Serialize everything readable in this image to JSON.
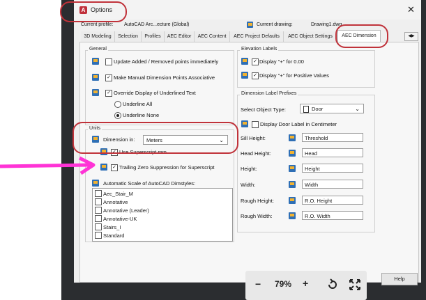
{
  "window": {
    "title": "Options",
    "close_glyph": "✕"
  },
  "profile": {
    "current_profile_label": "Current profile:",
    "current_profile_value": "AutoCAD Arc...ecture (Global)",
    "current_drawing_label": "Current drawing:",
    "current_drawing_value": "Drawing1.dwg"
  },
  "tabs": [
    "3D Modeling",
    "Selection",
    "Profiles",
    "AEC Editor",
    "AEC Content",
    "AEC Project Defaults",
    "AEC Object Settings",
    "AEC Dimension"
  ],
  "active_tab": "AEC Dimension",
  "tab_scroll": {
    "left": "◀",
    "right": "▶"
  },
  "general": {
    "title": "General",
    "update_points": {
      "label": "Update Added / Removed points immediately",
      "checked": false
    },
    "make_associative": {
      "label": "Make Manual Dimension Points Associative",
      "checked": true
    },
    "override_underlined": {
      "label": "Override Display of Underlined Text",
      "checked": true
    },
    "underline_all": {
      "label": "Underline All",
      "selected": false
    },
    "underline_none": {
      "label": "Underline None",
      "selected": true
    }
  },
  "units": {
    "title": "Units",
    "dimension_in_label": "Dimension in:",
    "dimension_in_value": "Meters",
    "use_superscript": {
      "label": "Use Superscript mm",
      "checked": true
    },
    "trailing_zero": {
      "label": "Trailing Zero Suppression for Superscript",
      "checked": true
    }
  },
  "auto_scale": {
    "label": "Automatic Scale of AutoCAD Dimstyles:",
    "items": [
      "Aec_Stair_M",
      "Annotative",
      "Annotative (Leader)",
      "Annotative-UK",
      "Stairs_I",
      "Standard"
    ]
  },
  "elevation": {
    "title": "Elevation Labels",
    "plus_zero": {
      "label": "Display \"+\" for 0.00",
      "checked": true
    },
    "plus_positive": {
      "label": "Display \"+\" for Positive Values",
      "checked": true
    }
  },
  "prefixes": {
    "title": "Dimension Label Prefixes",
    "select_object_label": "Select Object Type:",
    "select_object_value": "Door",
    "display_cm": {
      "label": "Display Door Label in Centimeter",
      "checked": false
    },
    "rows": [
      {
        "label": "Sill Height:",
        "value": "Threshold"
      },
      {
        "label": "Head Height:",
        "value": "Head"
      },
      {
        "label": "Height:",
        "value": "Height"
      },
      {
        "label": "Width:",
        "value": "Width"
      },
      {
        "label": "Rough Height:",
        "value": "R.O. Height"
      },
      {
        "label": "Rough Width:",
        "value": "R.O. Width"
      }
    ]
  },
  "buttons": {
    "help": "Help"
  },
  "zoom": {
    "minus": "−",
    "level": "79%",
    "plus": "+"
  },
  "colors": {
    "annotation": "#c0323a",
    "arrow": "#ff33d6",
    "accent_blue": "#2f6fb5"
  }
}
